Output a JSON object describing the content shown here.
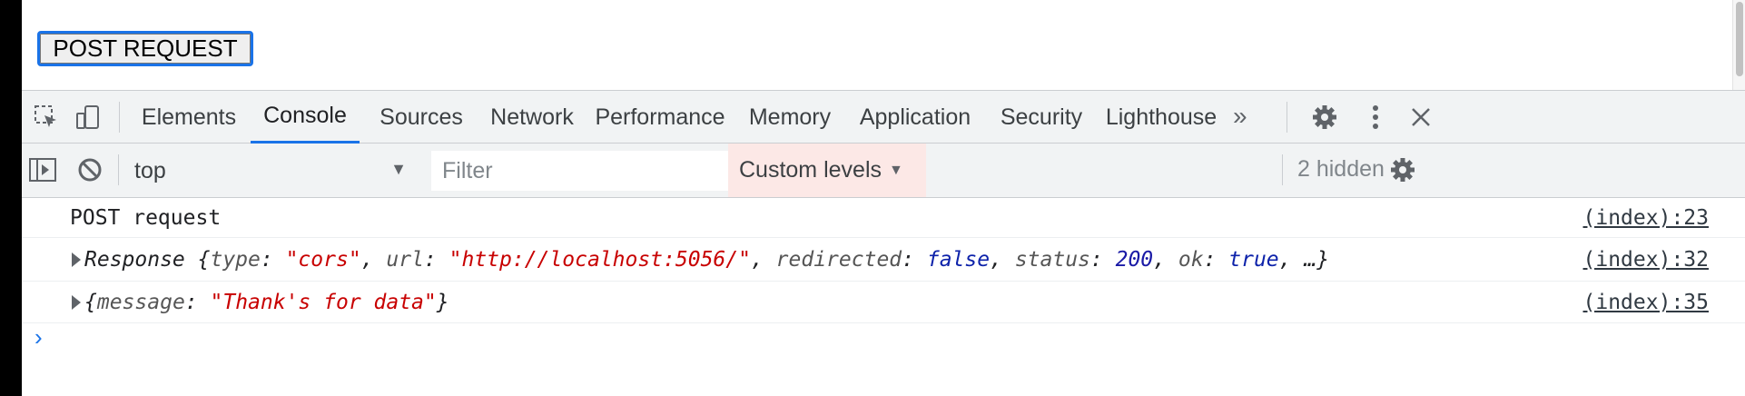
{
  "page": {
    "button_label": "POST REQUEST"
  },
  "devtools": {
    "tabs": [
      {
        "label": "Elements"
      },
      {
        "label": "Console"
      },
      {
        "label": "Sources"
      },
      {
        "label": "Network"
      },
      {
        "label": "Performance"
      },
      {
        "label": "Memory"
      },
      {
        "label": "Application"
      },
      {
        "label": "Security"
      },
      {
        "label": "Lighthouse"
      }
    ],
    "more_tabs": "»",
    "active_tab": "Console",
    "accent_color": "#1a73e8"
  },
  "toolbar": {
    "context": "top",
    "filter_placeholder": "Filter",
    "levels_label": "Custom levels",
    "hidden_count": "2 hidden"
  },
  "console": {
    "messages": [
      {
        "text": "POST request",
        "source": "(index):23"
      },
      {
        "source": "(index):32",
        "object_name": "Response",
        "fields": {
          "type_key": "type",
          "type_val": "\"cors\"",
          "url_key": "url",
          "url_val": "\"http://localhost:5056/\"",
          "redirected_key": "redirected",
          "redirected_val": "false",
          "status_key": "status",
          "status_val": "200",
          "ok_key": "ok",
          "ok_val": "true",
          "ellipsis": "…"
        }
      },
      {
        "source": "(index):35",
        "fields": {
          "message_key": "message",
          "message_val": "\"Thank's for data\""
        }
      }
    ],
    "prompt_symbol": "›"
  }
}
